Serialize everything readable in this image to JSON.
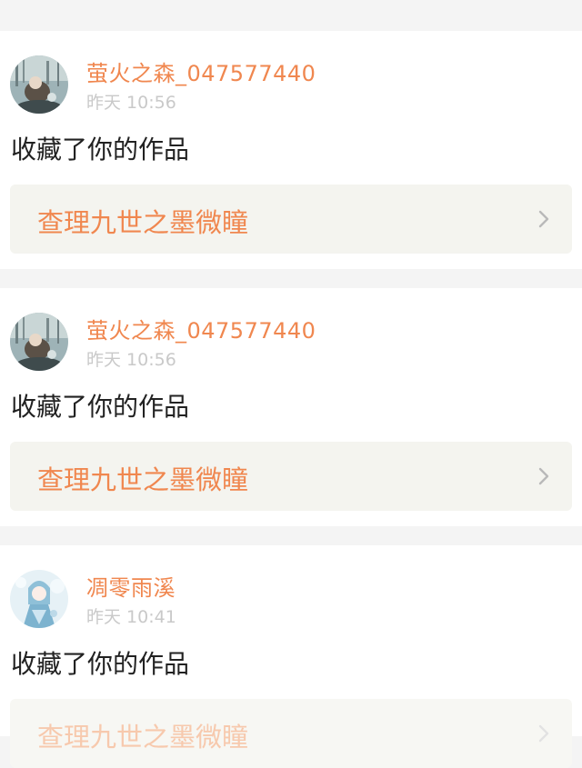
{
  "colors": {
    "accent": "#f0874f",
    "time": "#c9c9c9",
    "card_bg": "#ffffff",
    "page_bg": "#f4f4f4",
    "link_bg": "#f4f4ef"
  },
  "notifications": [
    {
      "username": "萤火之森_047577440",
      "time": "昨天 10:56",
      "action": "收藏了你的作品",
      "work_title": "查理九世之墨微瞳",
      "avatar_icon": "user-avatar-icon",
      "arrow_icon": "chevron-right-icon"
    },
    {
      "username": "萤火之森_047577440",
      "time": "昨天 10:56",
      "action": "收藏了你的作品",
      "work_title": "查理九世之墨微瞳",
      "avatar_icon": "user-avatar-icon",
      "arrow_icon": "chevron-right-icon"
    },
    {
      "username": "凋零雨溪",
      "time": "昨天 10:41",
      "action": "收藏了你的作品",
      "work_title": "查理九世之墨微瞳",
      "avatar_icon": "user-avatar-icon",
      "arrow_icon": "chevron-right-icon"
    }
  ]
}
